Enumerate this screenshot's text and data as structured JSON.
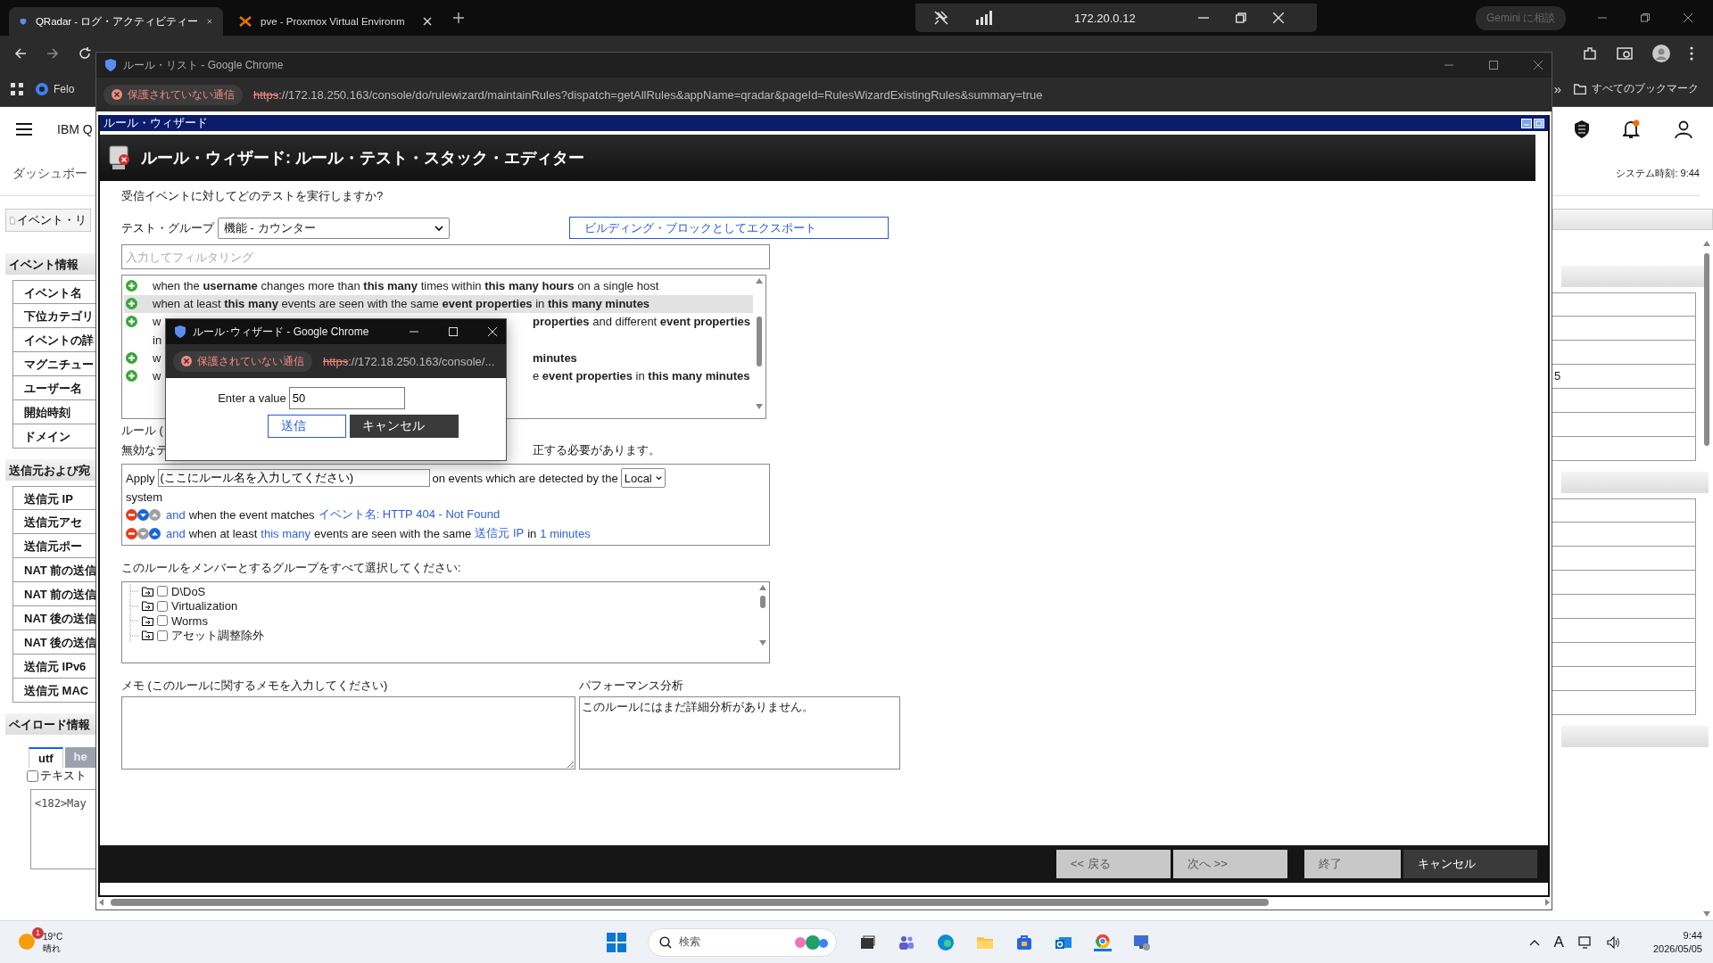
{
  "browser": {
    "tabs": [
      {
        "title": "QRadar - ログ・アクティビティー",
        "selected": true
      },
      {
        "title": "pve - Proxmox Virtual Environm",
        "selected": false
      }
    ],
    "remote_address": "172.20.0.12",
    "gemini": "Gemini に相談",
    "bookmark": "Felo",
    "more_bookmarks": "»",
    "all_bookmarks": "すべてのブックマーク"
  },
  "qradar": {
    "product": "IBM Q",
    "nav_tab": "ダッシュボー",
    "toolbar_button": "イベント・リ",
    "system_time": "システム時刻: 9:44",
    "sections": [
      {
        "title": "イベント情報",
        "rows": [
          {
            "label": "イベント名"
          },
          {
            "label": "下位カテゴリ"
          },
          {
            "label": "イベントの詳"
          },
          {
            "label": "マグニチュー",
            "value": "5"
          },
          {
            "label": "ユーザー名"
          },
          {
            "label": "開始時刻"
          },
          {
            "label": "ドメイン"
          }
        ]
      },
      {
        "title": "送信元および宛",
        "rows": [
          {
            "label": "送信元 IP"
          },
          {
            "label": "送信元アセ"
          },
          {
            "label": "送信元ポー"
          },
          {
            "label": "NAT 前の送信"
          },
          {
            "label": "NAT 前の送信"
          },
          {
            "label": "NAT 後の送信"
          },
          {
            "label": "NAT 後の送信"
          },
          {
            "label": "送信元 IPv6"
          },
          {
            "label": "送信元 MAC"
          }
        ]
      },
      {
        "title": "ペイロード情報"
      }
    ],
    "payload_tabs": [
      {
        "label": "utf",
        "selected": true
      },
      {
        "label": "he",
        "selected": false
      }
    ],
    "payload_checkbox": {
      "label": "テキスト",
      "checked": false
    },
    "payload_text": "<182>May"
  },
  "popup": {
    "title": "ルール・リスト - Google Chrome",
    "security": "保護されていない通信",
    "url_scheme": "https",
    "url_rest": "://172.18.250.163/console/do/rulewizard/maintainRules?dispatch=getAllRules&appName=qradar&pageId=RulesWizardExistingRules&summary=true"
  },
  "wizard": {
    "frame_title": "ルール・ウィザード",
    "heading": "ルール・ウィザード: ルール・テスト・スタック・エディター",
    "question": "受信イベントに対してどのテストを実行しますか?",
    "test_group": {
      "label": "テスト・グループ",
      "value": "機能 - カウンター"
    },
    "export_button": "ビルディング・ブロックとしてエクスポート",
    "filter": {
      "placeholder": "入力してフィルタリング"
    },
    "tests": [
      {
        "selected": false,
        "lines": [
          {
            "left": "when the **username** changes more than **this many** times within **this many hours** on a single host"
          }
        ]
      },
      {
        "selected": true,
        "lines": [
          {
            "left": "when at least **this many** events are seen with the same **event properties** in **this many minutes**"
          }
        ]
      },
      {
        "selected": false,
        "lines": [
          {
            "left": "w",
            "right": "**properties** and different **event properties**"
          },
          {
            "left": "in"
          }
        ]
      },
      {
        "selected": false,
        "lines": [
          {
            "left": "w",
            "right": "**minutes**"
          }
        ]
      },
      {
        "selected": false,
        "lines": [
          {
            "left": "w",
            "right": "e **event properties** in **this many minutes**"
          }
        ]
      }
    ],
    "rule_label": "ルール (",
    "notice_left": "無効なテ",
    "notice_right": "正する必要があります。",
    "rule": {
      "apply": "Apply",
      "name_value": "(ここにルール名を入力してください)",
      "detected_text": "on events which are detected by the",
      "system_select": "Local",
      "system_word": "system",
      "conditions": [
        {
          "controls": [
            {
              "kind": "remove",
              "enabled": true
            },
            {
              "kind": "down",
              "enabled": true
            },
            {
              "kind": "up",
              "enabled": false
            }
          ],
          "parts": [
            {
              "text": "and",
              "link": true
            },
            {
              "text": "when the event matches",
              "link": false
            },
            {
              "text": "イベント名: HTTP 404 - Not Found",
              "link": true
            }
          ]
        },
        {
          "controls": [
            {
              "kind": "remove",
              "enabled": true
            },
            {
              "kind": "down",
              "enabled": false
            },
            {
              "kind": "up",
              "enabled": true
            }
          ],
          "parts": [
            {
              "text": "and",
              "link": true
            },
            {
              "text": "when at least",
              "link": false
            },
            {
              "text": "this many",
              "link": true
            },
            {
              "text": "events are seen with the same",
              "link": false
            },
            {
              "text": "送信元 IP",
              "link": true
            },
            {
              "text": "in",
              "link": false
            },
            {
              "text": "1 minutes",
              "link": true
            }
          ]
        }
      ]
    },
    "groups_label": "このルールをメンバーとするグループをすべて選択してください:",
    "groups": [
      {
        "label": "D\\DoS",
        "checked": false
      },
      {
        "label": "Virtualization",
        "checked": false
      },
      {
        "label": "Worms",
        "checked": false
      },
      {
        "label": "アセット調整除外",
        "checked": false
      }
    ],
    "memo_label": "メモ (このルールに関するメモを入力してください)",
    "performance_label": "パフォーマンス分析",
    "performance_text": "このルールにはまだ詳細分析がありません。",
    "footer_buttons": [
      {
        "label": "<< 戻る",
        "kind": "nav",
        "disabled": true
      },
      {
        "label": "次へ >>",
        "kind": "nav",
        "disabled": true
      },
      {
        "label": "終了",
        "kind": "finish",
        "disabled": true
      },
      {
        "label": "キャンセル",
        "kind": "cancel",
        "disabled": false
      }
    ]
  },
  "dialog": {
    "title": "ルール･ウィザード - Google Chrome",
    "security": "保護されていない通信",
    "url_scheme": "https",
    "url_rest": "://172.18.250.163/console/...",
    "prompt": "Enter a value",
    "value": "50",
    "buttons": [
      {
        "label": "送信",
        "kind": "primary"
      },
      {
        "label": "キャンセル",
        "kind": "dark"
      }
    ]
  },
  "taskbar": {
    "weather": {
      "temp": "19°C",
      "condition": "晴れ",
      "badge": "1"
    },
    "search": "検索",
    "input_indicator": "A",
    "time": "9:44",
    "date": "2026/05/05"
  }
}
